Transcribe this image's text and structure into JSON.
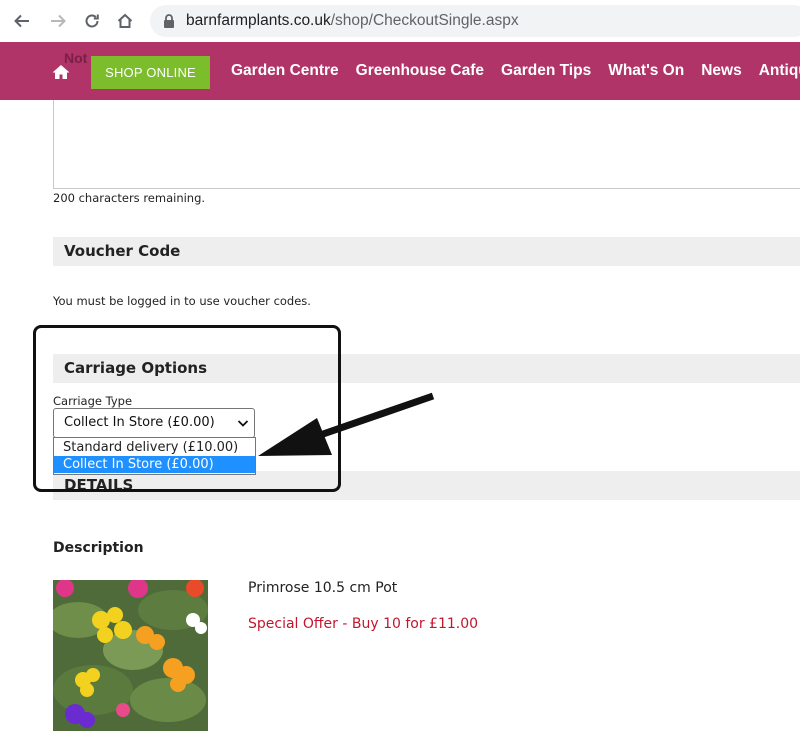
{
  "browser": {
    "url_domain": "barnfarmplants.co.uk",
    "url_path": "/shop/CheckoutSingle.aspx"
  },
  "header": {
    "ghost_text": "Not",
    "shop_button": "SHOP ONLINE",
    "nav": [
      "Garden Centre",
      "Greenhouse Cafe",
      "Garden Tips",
      "What's On",
      "News",
      "Antiqu"
    ],
    "color": "#b03468",
    "shop_color": "#7bbd2a"
  },
  "notes": {
    "chars_remaining": "200 characters remaining."
  },
  "voucher": {
    "title": "Voucher Code",
    "note": "You must be logged in to use voucher codes."
  },
  "carriage": {
    "title": "Carriage Options",
    "label": "Carriage Type",
    "selected": "Collect In Store (£0.00)",
    "options": [
      "Standard delivery (£10.00)",
      "Collect In Store (£0.00)"
    ]
  },
  "details": {
    "title": "DETAILS",
    "description_label": "Description"
  },
  "product": {
    "name": "Primrose 10.5 cm Pot",
    "offer": "Special Offer - Buy 10 for £11.00",
    "offer_color": "#c3162e"
  }
}
